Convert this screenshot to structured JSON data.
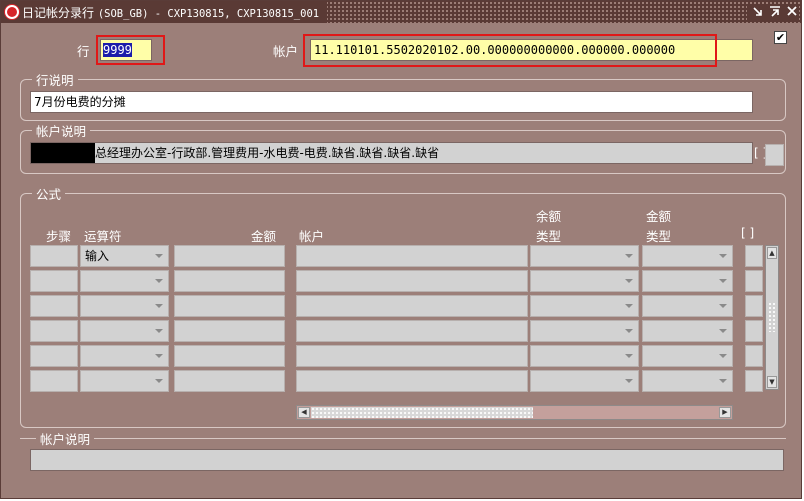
{
  "window": {
    "title": "日记帐分录行",
    "title_context": "(SOB_GB) - CXP130815, CXP130815_001",
    "controls": [
      "minimize-icon",
      "maximize-icon",
      "close-icon"
    ]
  },
  "header": {
    "line_label": "行",
    "line_value": "9999",
    "account_label": "帐户",
    "account_value": "11.110101.5502020102.00.000000000000.000000.000000",
    "checkbox_checked": true
  },
  "line_description": {
    "group_title": "行说明",
    "value": "7月份电费的分摊"
  },
  "account_description": {
    "group_title": "帐户说明",
    "value": "总经理办公室-行政部.管理费用-水电费-电费.缺省.缺省.缺省.缺省",
    "bracket_label": "[ ]"
  },
  "formula": {
    "group_title": "公式",
    "columns": {
      "step": "步骤",
      "operator": "运算符",
      "amount": "金额",
      "account": "帐户",
      "balance_type_line1": "余额",
      "balance_type_line2": "类型",
      "amount_type_line1": "金额",
      "amount_type_line2": "类型",
      "bracket": "[ ]"
    },
    "rows": [
      {
        "step": "",
        "operator": "输入",
        "amount": "",
        "account": "",
        "balance_type": "",
        "amount_type": ""
      },
      {
        "step": "",
        "operator": "",
        "amount": "",
        "account": "",
        "balance_type": "",
        "amount_type": ""
      },
      {
        "step": "",
        "operator": "",
        "amount": "",
        "account": "",
        "balance_type": "",
        "amount_type": ""
      },
      {
        "step": "",
        "operator": "",
        "amount": "",
        "account": "",
        "balance_type": "",
        "amount_type": ""
      },
      {
        "step": "",
        "operator": "",
        "amount": "",
        "account": "",
        "balance_type": "",
        "amount_type": ""
      },
      {
        "step": "",
        "operator": "",
        "amount": "",
        "account": "",
        "balance_type": "",
        "amount_type": ""
      }
    ]
  },
  "bottom_account_description": {
    "group_title": "帐户说明",
    "value": ""
  },
  "annotations": {
    "highlight_color": "#e01818"
  }
}
